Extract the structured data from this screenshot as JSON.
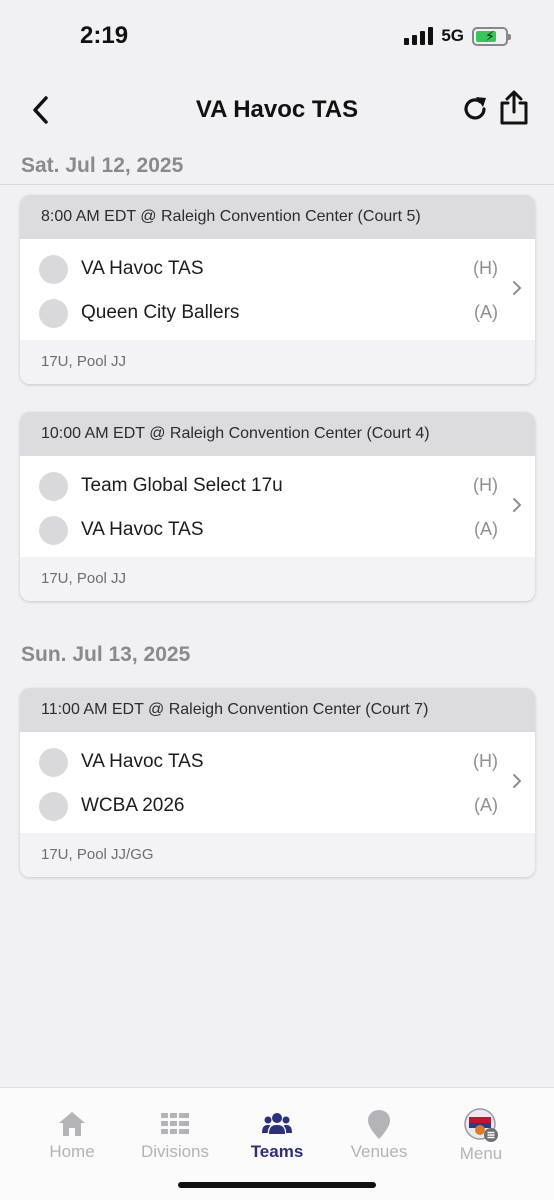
{
  "status_bar": {
    "time": "2:19",
    "network": "5G",
    "battery_icon": "battery-charging-icon",
    "signal_icon": "cell-signal-icon"
  },
  "nav": {
    "title": "VA Havoc TAS",
    "back_icon": "chevron-left-icon",
    "refresh_icon": "refresh-icon",
    "share_icon": "share-icon"
  },
  "days": [
    {
      "label": "Sat. Jul 12, 2025",
      "games": [
        {
          "header": "8:00 AM EDT @ Raleigh Convention Center (Court 5)",
          "teams": [
            {
              "name": "VA Havoc TAS",
              "side": "(H)"
            },
            {
              "name": "Queen City Ballers",
              "side": "(A)"
            }
          ],
          "footer": "17U, Pool JJ"
        },
        {
          "header": "10:00 AM EDT @ Raleigh Convention Center (Court 4)",
          "teams": [
            {
              "name": "Team Global Select 17u",
              "side": "(H)"
            },
            {
              "name": "VA Havoc TAS",
              "side": "(A)"
            }
          ],
          "footer": "17U, Pool JJ"
        }
      ]
    },
    {
      "label": "Sun. Jul 13, 2025",
      "games": [
        {
          "header": "11:00 AM EDT @ Raleigh Convention Center (Court 7)",
          "teams": [
            {
              "name": "VA Havoc TAS",
              "side": "(H)"
            },
            {
              "name": "WCBA 2026",
              "side": "(A)"
            }
          ],
          "footer": "17U, Pool JJ/GG"
        }
      ]
    }
  ],
  "tabs": [
    {
      "label": "Home",
      "icon": "home-icon",
      "active": false
    },
    {
      "label": "Divisions",
      "icon": "list-icon",
      "active": false
    },
    {
      "label": "Teams",
      "icon": "people-icon",
      "active": true
    },
    {
      "label": "Venues",
      "icon": "location-pin-icon",
      "active": false
    },
    {
      "label": "Menu",
      "icon": "menu-logo-icon",
      "active": false
    }
  ],
  "colors": {
    "accent": "#2b2f7e",
    "inactive_tab": "#b3b3b8",
    "battery": "#34c759"
  }
}
